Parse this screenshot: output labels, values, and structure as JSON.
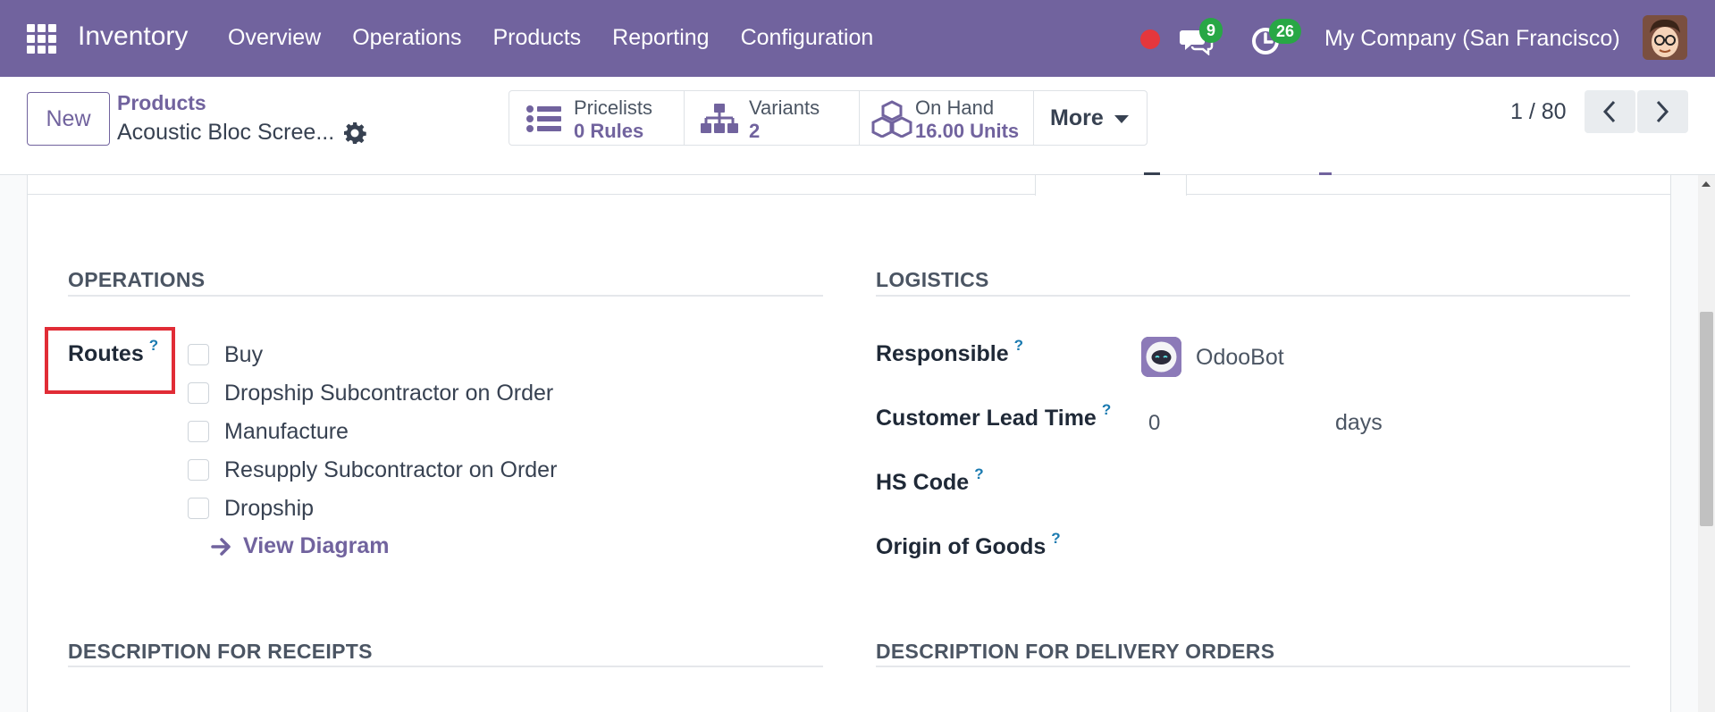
{
  "navbar": {
    "brand": "Inventory",
    "menu": [
      "Overview",
      "Operations",
      "Products",
      "Reporting",
      "Configuration"
    ],
    "messages_count": "9",
    "activities_count": "26",
    "company": "My Company (San Francisco)",
    "accent_color": "#71639e"
  },
  "control": {
    "new_label": "New",
    "breadcrumb_parent": "Products",
    "breadcrumb_current": "Acoustic Bloc Scree...",
    "smart_buttons": {
      "pricelists": {
        "title": "Pricelists",
        "value": "0 Rules",
        "icon": "list-icon"
      },
      "variants": {
        "title": "Variants",
        "value": "2",
        "icon": "sitemap-icon"
      },
      "onhand": {
        "title": "On Hand",
        "value": "16.00 Units",
        "icon": "cubes-icon"
      },
      "more": {
        "label": "More"
      }
    },
    "pager": "1 / 80"
  },
  "form": {
    "operations_title": "OPERATIONS",
    "logistics_title": "LOGISTICS",
    "routes_label": "Routes",
    "routes": [
      {
        "label": "Buy",
        "checked": false
      },
      {
        "label": "Dropship Subcontractor on Order",
        "checked": false
      },
      {
        "label": "Manufacture",
        "checked": false
      },
      {
        "label": "Resupply Subcontractor on Order",
        "checked": false
      },
      {
        "label": "Dropship",
        "checked": false
      }
    ],
    "view_diagram": "View Diagram",
    "responsible_label": "Responsible",
    "responsible_value": "OdooBot",
    "lead_time_label": "Customer Lead Time",
    "lead_time_value": "0",
    "lead_time_unit": "days",
    "hs_code_label": "HS Code",
    "origin_label": "Origin of Goods",
    "desc_receipts_title": "DESCRIPTION FOR RECEIPTS",
    "desc_delivery_title": "DESCRIPTION FOR DELIVERY ORDERS",
    "help_mark": "?"
  }
}
